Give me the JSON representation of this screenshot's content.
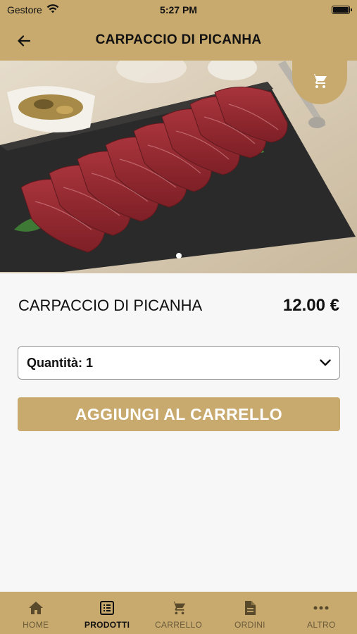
{
  "status": {
    "carrier": "Gestore",
    "time": "5:27 PM"
  },
  "header": {
    "title": "CARPACCIO DI PICANHA"
  },
  "product": {
    "name": "CARPACCIO DI PICANHA",
    "price": "12.00 €",
    "quantity_label": "Quantità: 1",
    "add_to_cart_label": "AGGIUNGI AL CARRELLO",
    "image_page": 1,
    "image_count": 1
  },
  "tabs": [
    {
      "label": "HOME",
      "icon": "home-icon",
      "active": false
    },
    {
      "label": "PRODOTTI",
      "icon": "list-icon",
      "active": true
    },
    {
      "label": "CARRELLO",
      "icon": "cart-icon",
      "active": false
    },
    {
      "label": "ORDINI",
      "icon": "document-icon",
      "active": false
    },
    {
      "label": "ALTRO",
      "icon": "more-icon",
      "active": false
    }
  ],
  "colors": {
    "brand": "#c8aa6e",
    "background": "#f7f7f7"
  }
}
